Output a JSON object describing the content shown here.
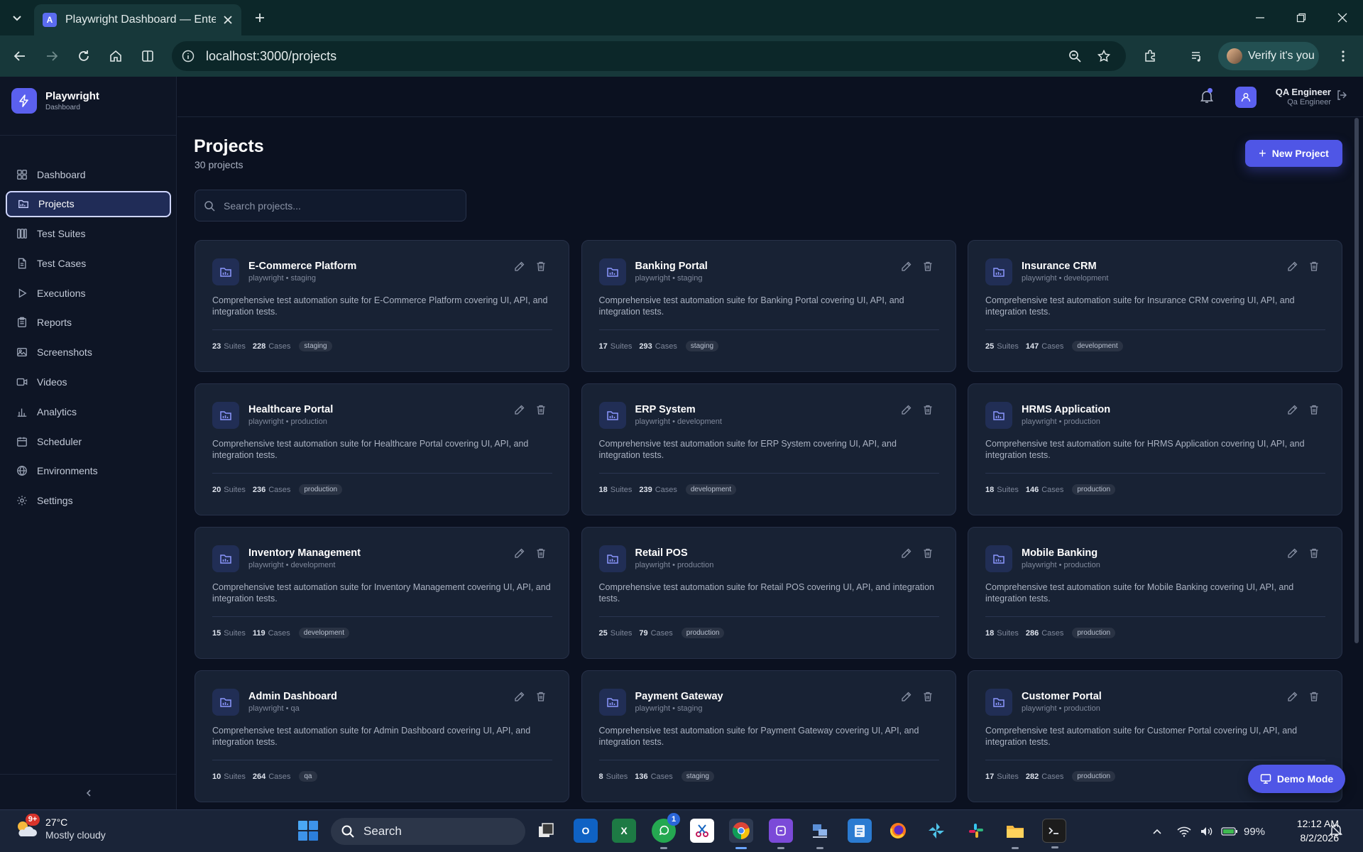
{
  "browser": {
    "tab_title": "Playwright Dashboard — Enterprise",
    "tab_favicon": "A",
    "url": "localhost:3000/projects",
    "verify_label": "Verify it's you"
  },
  "app": {
    "brand_name": "Playwright",
    "brand_sub": "Dashboard",
    "nav": [
      {
        "label": "Dashboard",
        "icon": "grid-icon",
        "active": false
      },
      {
        "label": "Projects",
        "icon": "folder-icon",
        "active": true
      },
      {
        "label": "Test Suites",
        "icon": "columns-icon",
        "active": false
      },
      {
        "label": "Test Cases",
        "icon": "document-icon",
        "active": false
      },
      {
        "label": "Executions",
        "icon": "play-icon",
        "active": false
      },
      {
        "label": "Reports",
        "icon": "clipboard-icon",
        "active": false
      },
      {
        "label": "Screenshots",
        "icon": "image-icon",
        "active": false
      },
      {
        "label": "Videos",
        "icon": "video-icon",
        "active": false
      },
      {
        "label": "Analytics",
        "icon": "bar-chart-icon",
        "active": false
      },
      {
        "label": "Scheduler",
        "icon": "calendar-icon",
        "active": false
      },
      {
        "label": "Environments",
        "icon": "globe-icon",
        "active": false
      },
      {
        "label": "Settings",
        "icon": "gear-icon",
        "active": false
      }
    ],
    "user": {
      "name": "QA Engineer",
      "role": "Qa Engineer"
    }
  },
  "page": {
    "title": "Projects",
    "count": "30 projects",
    "new_project_label": "New Project",
    "search_placeholder": "Search projects...",
    "demo_mode_label": "Demo Mode",
    "suites_label": "Suites",
    "cases_label": "Cases"
  },
  "projects": [
    {
      "name": "E-Commerce Platform",
      "meta": "playwright • staging",
      "desc": "Comprehensive test automation suite for E-Commerce Platform covering UI, API, and integration tests.",
      "suites": "23",
      "cases": "228",
      "env": "staging"
    },
    {
      "name": "Banking Portal",
      "meta": "playwright • staging",
      "desc": "Comprehensive test automation suite for Banking Portal covering UI, API, and integration tests.",
      "suites": "17",
      "cases": "293",
      "env": "staging"
    },
    {
      "name": "Insurance CRM",
      "meta": "playwright • development",
      "desc": "Comprehensive test automation suite for Insurance CRM covering UI, API, and integration tests.",
      "suites": "25",
      "cases": "147",
      "env": "development"
    },
    {
      "name": "Healthcare Portal",
      "meta": "playwright • production",
      "desc": "Comprehensive test automation suite for Healthcare Portal covering UI, API, and integration tests.",
      "suites": "20",
      "cases": "236",
      "env": "production"
    },
    {
      "name": "ERP System",
      "meta": "playwright • development",
      "desc": "Comprehensive test automation suite for ERP System covering UI, API, and integration tests.",
      "suites": "18",
      "cases": "239",
      "env": "development"
    },
    {
      "name": "HRMS Application",
      "meta": "playwright • production",
      "desc": "Comprehensive test automation suite for HRMS Application covering UI, API, and integration tests.",
      "suites": "18",
      "cases": "146",
      "env": "production"
    },
    {
      "name": "Inventory Management",
      "meta": "playwright • development",
      "desc": "Comprehensive test automation suite for Inventory Management covering UI, API, and integration tests.",
      "suites": "15",
      "cases": "119",
      "env": "development"
    },
    {
      "name": "Retail POS",
      "meta": "playwright • production",
      "desc": "Comprehensive test automation suite for Retail POS covering UI, API, and integration tests.",
      "suites": "25",
      "cases": "79",
      "env": "production"
    },
    {
      "name": "Mobile Banking",
      "meta": "playwright • production",
      "desc": "Comprehensive test automation suite for Mobile Banking covering UI, API, and integration tests.",
      "suites": "18",
      "cases": "286",
      "env": "production"
    },
    {
      "name": "Admin Dashboard",
      "meta": "playwright • qa",
      "desc": "Comprehensive test automation suite for Admin Dashboard covering UI, API, and integration tests.",
      "suites": "10",
      "cases": "264",
      "env": "qa"
    },
    {
      "name": "Payment Gateway",
      "meta": "playwright • staging",
      "desc": "Comprehensive test automation suite for Payment Gateway covering UI, API, and integration tests.",
      "suites": "8",
      "cases": "136",
      "env": "staging"
    },
    {
      "name": "Customer Portal",
      "meta": "playwright • production",
      "desc": "Comprehensive test automation suite for Customer Portal covering UI, API, and integration tests.",
      "suites": "17",
      "cases": "282",
      "env": "production"
    }
  ],
  "taskbar": {
    "weather_badge": "9+",
    "weather_temp": "27°C",
    "weather_desc": "Mostly cloudy",
    "search_label": "Search",
    "whatsapp_badge": "1",
    "battery": "99%",
    "time": "12:12 AM",
    "date": "8/2/2026"
  },
  "colors": {
    "accent": "#4f56e6",
    "background": "#0b1120",
    "card": "#182234"
  }
}
